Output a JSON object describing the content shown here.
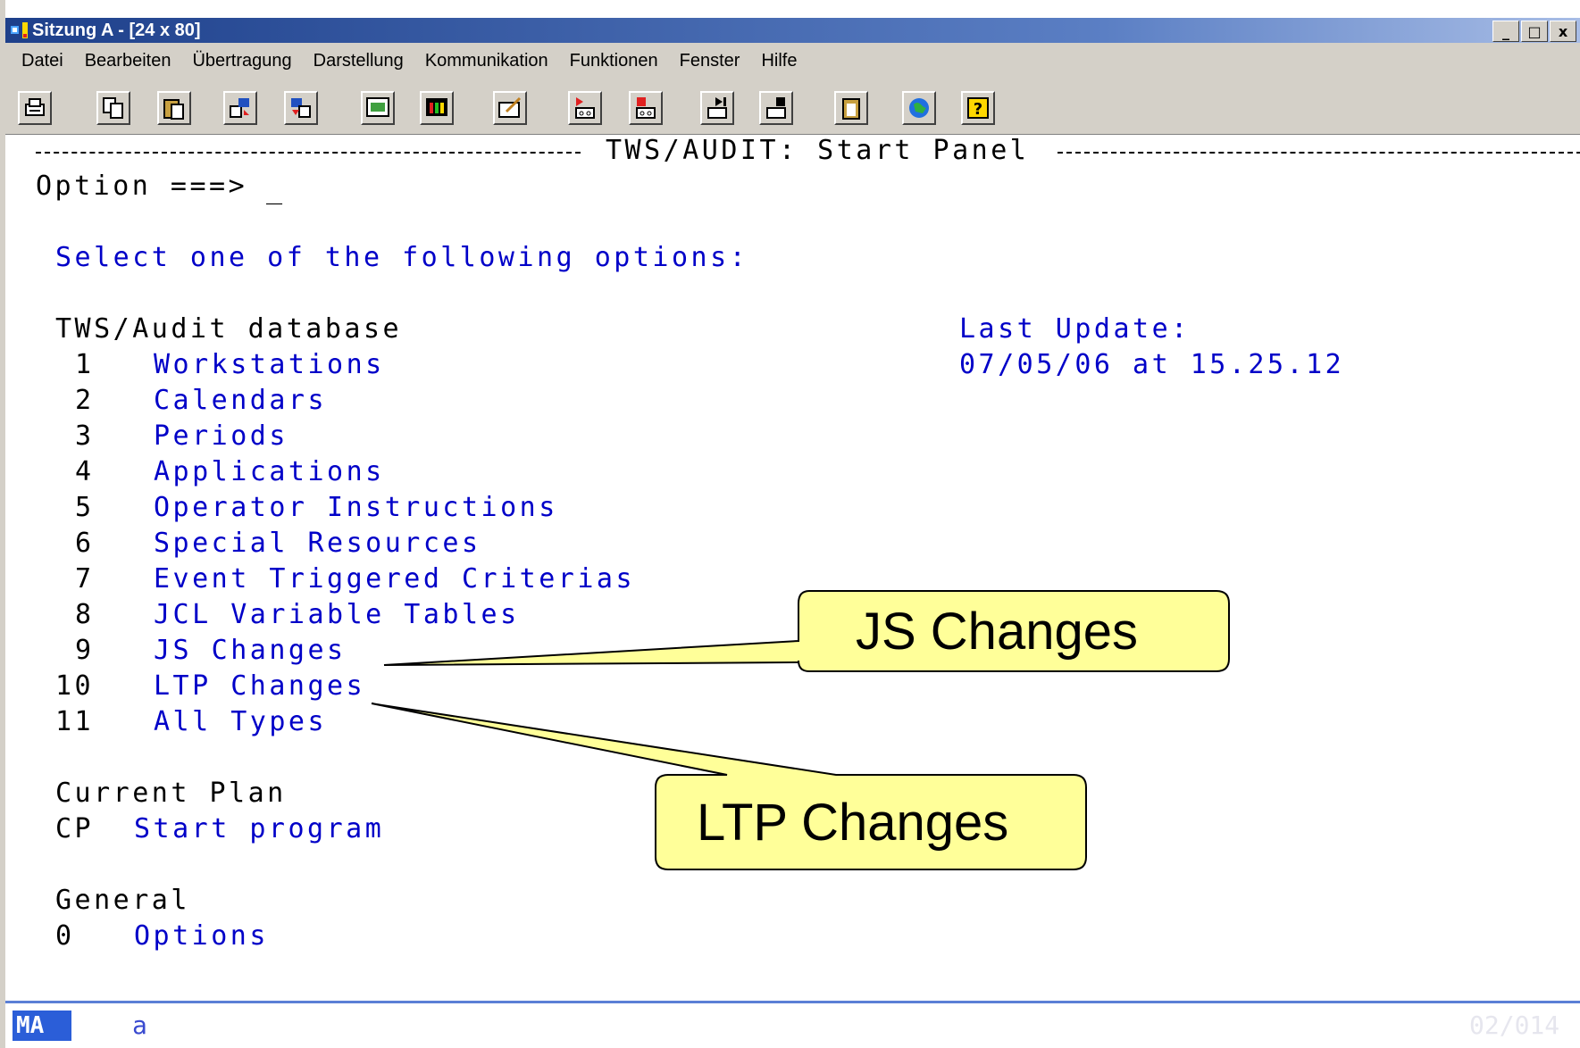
{
  "window": {
    "title": "Sitzung A - [24 x 80]",
    "controls": [
      "_",
      "□",
      "x"
    ]
  },
  "menu": {
    "items": [
      "Datei",
      "Bearbeiten",
      "Übertragung",
      "Darstellung",
      "Kommunikation",
      "Funktionen",
      "Fenster",
      "Hilfe"
    ]
  },
  "toolbar": {
    "buttons": [
      {
        "name": "print-icon"
      },
      {
        "name": "copy-icon"
      },
      {
        "name": "paste-icon"
      },
      {
        "name": "send-icon"
      },
      {
        "name": "receive-icon"
      },
      {
        "name": "display-setup-icon"
      },
      {
        "name": "color-map-icon"
      },
      {
        "name": "edit-macro-icon"
      },
      {
        "name": "record-macro-icon"
      },
      {
        "name": "stop-macro-icon"
      },
      {
        "name": "play-macro-icon"
      },
      {
        "name": "pause-macro-icon"
      },
      {
        "name": "clipboard-icon"
      },
      {
        "name": "help-globe-icon"
      },
      {
        "name": "help-icon"
      }
    ]
  },
  "terminal": {
    "header": "TWS/AUDIT: Start Panel",
    "option_prompt": "Option ===>",
    "cursor": "_",
    "instruction": "Select one of the following options:",
    "section_database": "TWS/Audit database",
    "last_update_label": "Last Update:",
    "last_update_value": "07/05/06 at 15.25.12",
    "options": [
      {
        "num": "1",
        "label": "Workstations"
      },
      {
        "num": "2",
        "label": "Calendars"
      },
      {
        "num": "3",
        "label": "Periods"
      },
      {
        "num": "4",
        "label": "Applications"
      },
      {
        "num": "5",
        "label": "Operator Instructions"
      },
      {
        "num": "6",
        "label": "Special Resources"
      },
      {
        "num": "7",
        "label": "Event Triggered Criterias"
      },
      {
        "num": "8",
        "label": "JCL Variable Tables"
      },
      {
        "num": "9",
        "label": "JS Changes"
      },
      {
        "num": "10",
        "label": "LTP Changes"
      },
      {
        "num": "11",
        "label": "All Types"
      }
    ],
    "section_plan": "Current Plan",
    "plan_code": "CP",
    "plan_label": "Start program",
    "section_general": "General",
    "general_code": "0",
    "general_label": "Options"
  },
  "callouts": {
    "js": "JS Changes",
    "ltp": "LTP Changes"
  },
  "status": {
    "mode": "MA",
    "session": "a",
    "position": "02/014"
  },
  "colors": {
    "terminal_blue": "#0000c8",
    "callout_fill": "#ffff99",
    "status_blue": "#2b5ed8"
  }
}
